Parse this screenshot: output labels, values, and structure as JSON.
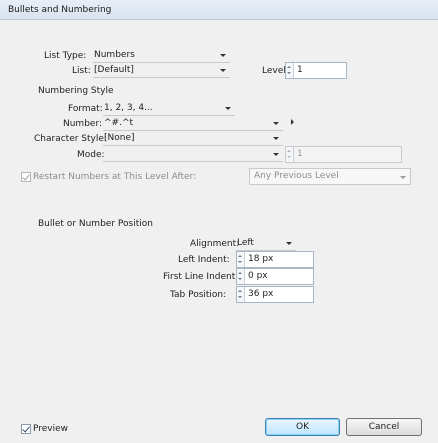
{
  "window": {
    "title": "Bullets and Numbering"
  },
  "list_type": {
    "label": "List Type:",
    "value": "Numbers"
  },
  "list": {
    "label": "List:",
    "value": "[Default]"
  },
  "level": {
    "label": "Level:",
    "value": "1"
  },
  "numbering_style": {
    "heading": "Numbering Style",
    "format": {
      "label": "Format:",
      "value": "1, 2, 3, 4..."
    },
    "number": {
      "label": "Number:",
      "value": "^#.^t"
    },
    "character_style": {
      "label": "Character Style:",
      "value": "[None]"
    },
    "mode": {
      "label": "Mode:",
      "value": "",
      "spin_value": "1"
    },
    "restart": {
      "label": "Restart Numbers at This Level After:",
      "checked": true,
      "value": "Any Previous Level"
    }
  },
  "position": {
    "heading": "Bullet or Number Position",
    "alignment": {
      "label": "Alignment:",
      "value": "Left"
    },
    "left_indent": {
      "label": "Left Indent:",
      "value": "18 px"
    },
    "first_line_indent": {
      "label": "First Line Indent:",
      "value": "0 px"
    },
    "tab_position": {
      "label": "Tab Position:",
      "value": "36 px"
    }
  },
  "footer": {
    "preview_label": "Preview",
    "preview_checked": true,
    "ok_label": "OK",
    "cancel_label": "Cancel"
  }
}
